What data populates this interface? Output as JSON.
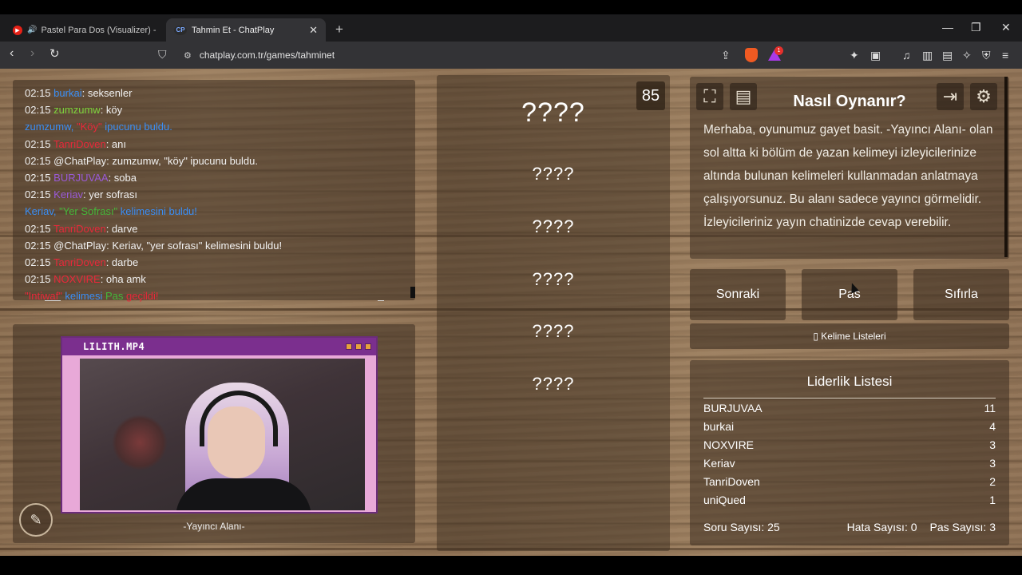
{
  "browser": {
    "tabs": [
      {
        "title": "Pastel Para Dos (Visualizer) - YouT",
        "favicon": "youtube-icon",
        "audio": true
      },
      {
        "title": "Tahmin Et - ChatPlay",
        "favicon": "chatplay-icon",
        "favicon_text": "CP"
      }
    ],
    "url": "chatplay.com.tr/games/tahminet"
  },
  "chat": {
    "messages": [
      {
        "time": "02:15",
        "user": "burkai",
        "user_color": "#3a8ef5",
        "text": ": seksenler"
      },
      {
        "time": "02:15",
        "user": "zumzumw",
        "user_color": "#7dd33c",
        "text": ": köy"
      },
      {
        "system": true,
        "parts": [
          "zumzumw, ",
          "\"Köy\"",
          " ipucunu buldu."
        ]
      },
      {
        "time": "02:15",
        "user": "TanriDoven",
        "user_color": "#e8283a",
        "text": ": anı"
      },
      {
        "time": "02:15",
        "user": "@ChatPlay",
        "user_color": "#f1f1f1",
        "text": ": zumzumw, \"köy\" ipucunu buldu."
      },
      {
        "time": "02:15",
        "user": "BURJUVAA",
        "user_color": "#9a5ad8",
        "text": ": soba"
      },
      {
        "time": "02:15",
        "user": "Keriav",
        "user_color": "#9a5ad8",
        "text": ": yer sofrası"
      },
      {
        "system": true,
        "parts": [
          "Keriav, ",
          "\"Yer Sofrası\"",
          " kelimesini buldu!"
        ]
      },
      {
        "time": "02:15",
        "user": "TanriDoven",
        "user_color": "#e8283a",
        "text": ": darve"
      },
      {
        "time": "02:15",
        "user": "@ChatPlay",
        "user_color": "#f1f1f1",
        "text": ": Keriav, \"yer sofrası\" kelimesini buldu!"
      },
      {
        "time": "02:15",
        "user": "TanriDoven",
        "user_color": "#e8283a",
        "text": ": darbe"
      },
      {
        "time": "02:15",
        "user": "NOXVIRE",
        "user_color": "#e8283a",
        "text": ": oha amk"
      },
      {
        "system": true,
        "parts": [
          "\"Intiwaf\"",
          " kelimesi ",
          "Pas",
          " geçildi!"
        ]
      }
    ]
  },
  "camera": {
    "window_title": "LILITH.MP4",
    "label": "-Yayıncı Alanı-"
  },
  "words": {
    "timer": "85",
    "items": [
      "????",
      "????",
      "????",
      "????",
      "????",
      "????"
    ]
  },
  "how_to": {
    "title": "Nasıl Oynanır?",
    "text": "Merhaba, oyunumuz gayet basit. -Yayıncı Alanı- olan sol altta ki bölüm de yazan kelimeyi izleyicilerinize altında bulunan kelimeleri kullanmadan anlatmaya çalışıyorsunuz. Bu alanı sadece yayıncı görmelidir. İzleyicileriniz yayın chatinizde cevap verebilir."
  },
  "controls": {
    "next": "Sonraki",
    "pass": "Pas",
    "reset": "Sıfırla",
    "word_lists": "Kelime Listeleri"
  },
  "leaderboard": {
    "title": "Liderlik Listesi",
    "rows": [
      {
        "name": "BURJUVAA",
        "score": "11"
      },
      {
        "name": "burkai",
        "score": "4"
      },
      {
        "name": "NOXVIRE",
        "score": "3"
      },
      {
        "name": "Keriav",
        "score": "3"
      },
      {
        "name": "TanriDoven",
        "score": "2"
      },
      {
        "name": "uniQued",
        "score": "1"
      }
    ],
    "stats": {
      "questions": "Soru Sayısı: 25",
      "errors": "Hata Sayısı: 0",
      "passes": "Pas Sayısı: 3"
    }
  }
}
